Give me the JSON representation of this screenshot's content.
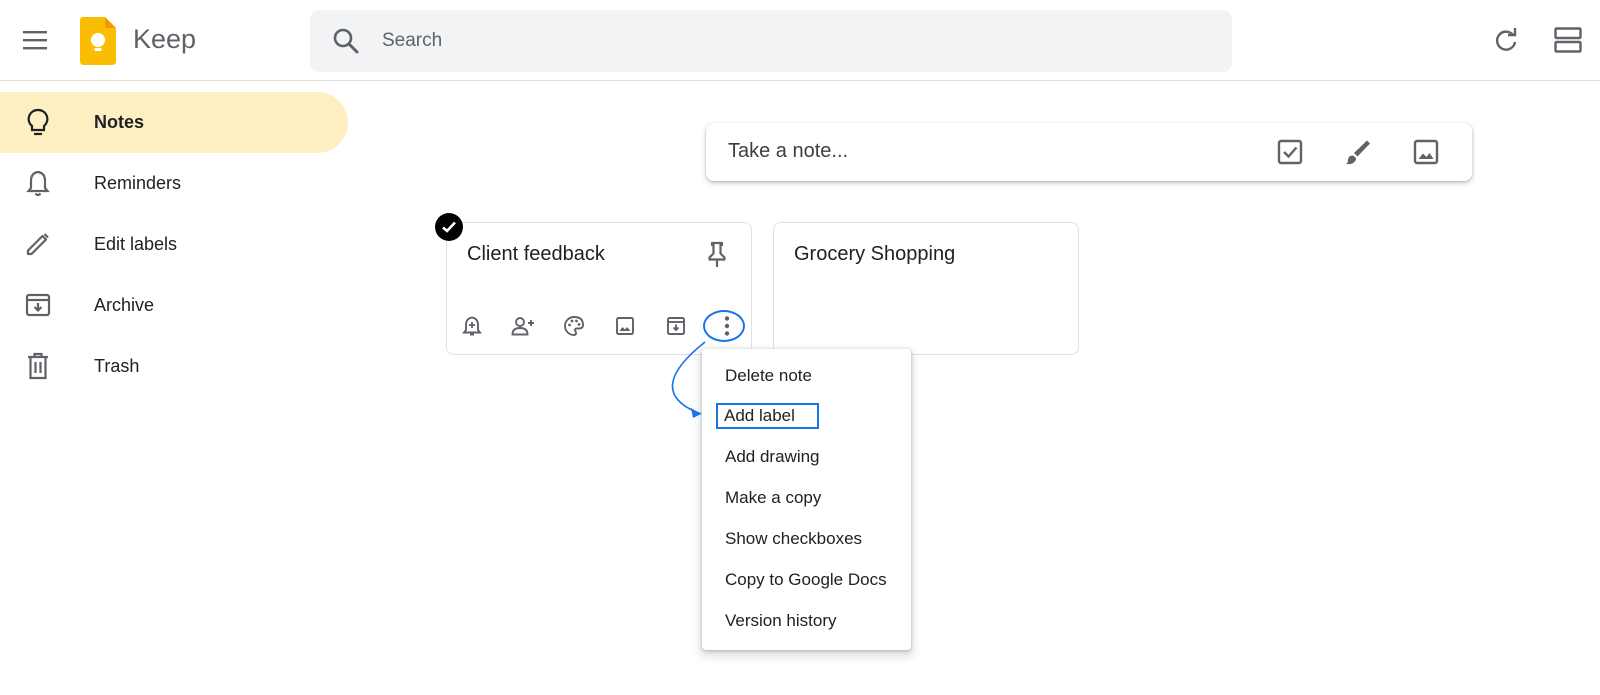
{
  "header": {
    "app_title": "Keep",
    "search_placeholder": "Search",
    "icons": [
      "hamburger-menu-icon",
      "keep-logo",
      "search-icon",
      "refresh-icon",
      "list-view-icon"
    ]
  },
  "sidebar": {
    "items": [
      {
        "label": "Notes",
        "icon": "lightbulb-icon",
        "active": true
      },
      {
        "label": "Reminders",
        "icon": "bell-icon",
        "active": false
      },
      {
        "label": "Edit labels",
        "icon": "pencil-icon",
        "active": false
      },
      {
        "label": "Archive",
        "icon": "archive-icon",
        "active": false
      },
      {
        "label": "Trash",
        "icon": "trash-icon",
        "active": false
      }
    ]
  },
  "take_note": {
    "placeholder": "Take a note...",
    "actions": [
      "new-list-icon",
      "new-drawing-icon",
      "new-image-icon"
    ]
  },
  "notes": [
    {
      "title": "Client feedback",
      "selected": true
    },
    {
      "title": "Grocery Shopping",
      "selected": false
    }
  ],
  "note_toolbar": [
    "remind-icon",
    "collaborator-icon",
    "palette-icon",
    "image-icon",
    "archive-icon",
    "more-icon"
  ],
  "context_menu": {
    "items": [
      "Delete note",
      "Add label",
      "Add drawing",
      "Make a copy",
      "Show checkboxes",
      "Copy to Google Docs",
      "Version history"
    ],
    "highlighted_index": 1
  },
  "colors": {
    "active_nav": "#feefc3",
    "highlight": "#1a73e8",
    "logo": "#fbbc04",
    "icon": "#5f6368"
  }
}
